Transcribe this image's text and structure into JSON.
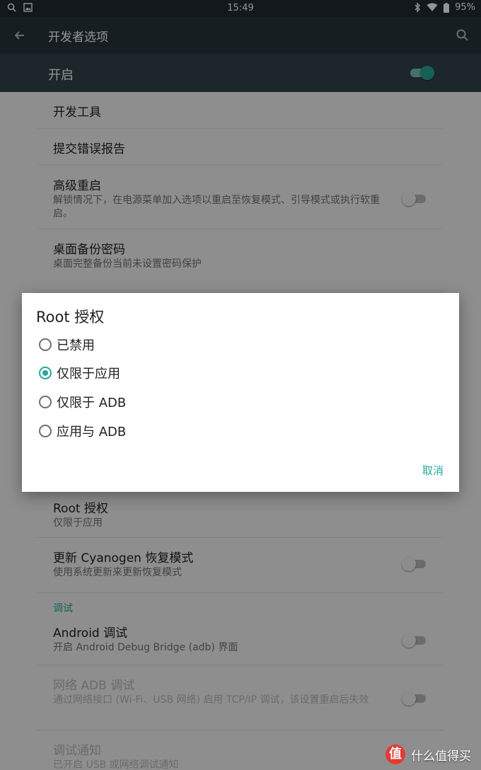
{
  "status_bar": {
    "time": "15:49",
    "battery": "95%",
    "left_icons": [
      "search-icon",
      "image-icon"
    ],
    "right_icons": [
      "bluetooth-icon",
      "wifi-icon",
      "battery-icon"
    ]
  },
  "toolbar": {
    "title": "开发者选项",
    "back_icon": "arrow-left-icon",
    "search_icon": "search-icon"
  },
  "master_switch": {
    "label": "开启",
    "state": "on"
  },
  "settings": {
    "dev_tools": {
      "title": "开发工具"
    },
    "bug_report": {
      "title": "提交错误报告"
    },
    "advanced_reboot": {
      "title": "高级重启",
      "summary": "解锁情况下，在电源菜单加入选项以重启至恢复模式、引导模式或执行软重启。",
      "state": "off"
    },
    "backup_password": {
      "title": "桌面备份密码",
      "summary": "桌面完整备份当前未设置密码保护"
    },
    "root_access": {
      "title": "Root 授权",
      "summary": "仅限于应用"
    },
    "update_recovery": {
      "title": "更新 Cyanogen 恢复模式",
      "summary": "使用系统更新来更新恢复模式",
      "state": "off"
    },
    "debug_section": "调试",
    "android_debug": {
      "title": "Android 调试",
      "summary": "开启 Android Debug Bridge (adb) 界面",
      "state": "off"
    },
    "network_adb": {
      "title": "网络 ADB 调试",
      "summary": "通过网络接口 (Wi-Fi、USB 网络) 启用 TCP/IP 调试，该设置重启后失效",
      "state": "off"
    },
    "debug_notify": {
      "title": "调试通知",
      "summary": "已开启 USB 或网络调试通知"
    }
  },
  "dialog": {
    "title": "Root 授权",
    "options": [
      {
        "label": "已禁用",
        "checked": false
      },
      {
        "label": "仅限于应用",
        "checked": true
      },
      {
        "label": "仅限于 ADB",
        "checked": false
      },
      {
        "label": "应用与 ADB",
        "checked": false
      }
    ],
    "cancel": "取消"
  },
  "watermark": {
    "logo": "值",
    "text": "什么值得买"
  },
  "colors": {
    "accent": "#26a69a",
    "toolbar": "#27353c",
    "status_bar": "#1f2a30",
    "master_bar": "#33434b"
  }
}
